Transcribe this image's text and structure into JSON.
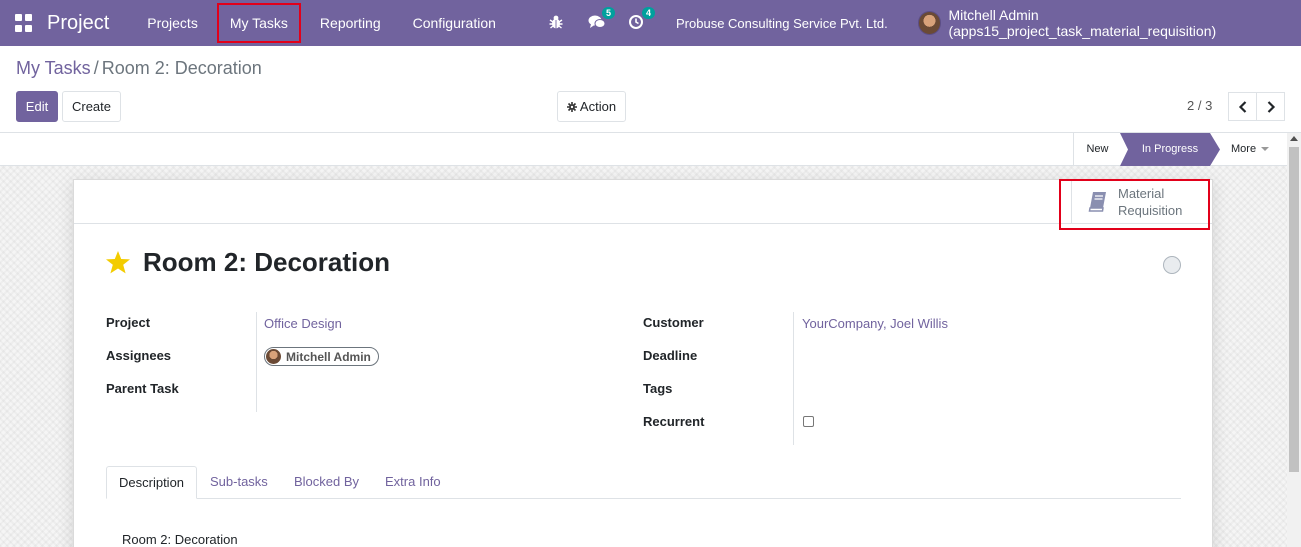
{
  "navbar": {
    "app_name": "Project",
    "menu": [
      "Projects",
      "My Tasks",
      "Reporting",
      "Configuration"
    ],
    "highlighted_menu": "My Tasks",
    "messages_count": "5",
    "activities_count": "4",
    "company": "Probuse Consulting Service Pvt. Ltd.",
    "user": "Mitchell Admin (apps15_project_task_material_requisition)"
  },
  "breadcrumb": {
    "parent": "My Tasks",
    "separator": "/",
    "current": "Room 2: Decoration"
  },
  "toolbar": {
    "edit_label": "Edit",
    "create_label": "Create",
    "action_label": "Action",
    "pager": "2 / 3"
  },
  "statusbar": {
    "stages": [
      "New",
      "In Progress"
    ],
    "active_stage": "In Progress",
    "more_label": "More"
  },
  "smart_button": {
    "line1": "Material",
    "line2": "Requisition"
  },
  "task": {
    "title": "Room 2: Decoration",
    "starred": true
  },
  "fields_left": {
    "project_label": "Project",
    "project_value": "Office Design",
    "assignees_label": "Assignees",
    "assignee_value": "Mitchell Admin",
    "parent_task_label": "Parent Task"
  },
  "fields_right": {
    "customer_label": "Customer",
    "customer_value": "YourCompany, Joel Willis",
    "deadline_label": "Deadline",
    "tags_label": "Tags",
    "recurrent_label": "Recurrent",
    "recurrent_checked": false
  },
  "tabs": [
    "Description",
    "Sub-tasks",
    "Blocked By",
    "Extra Info"
  ],
  "active_tab": "Description",
  "description": "Room 2: Decoration",
  "colors": {
    "brand": "#71639e",
    "highlight": "#e2001a",
    "star": "#f3cc00"
  }
}
